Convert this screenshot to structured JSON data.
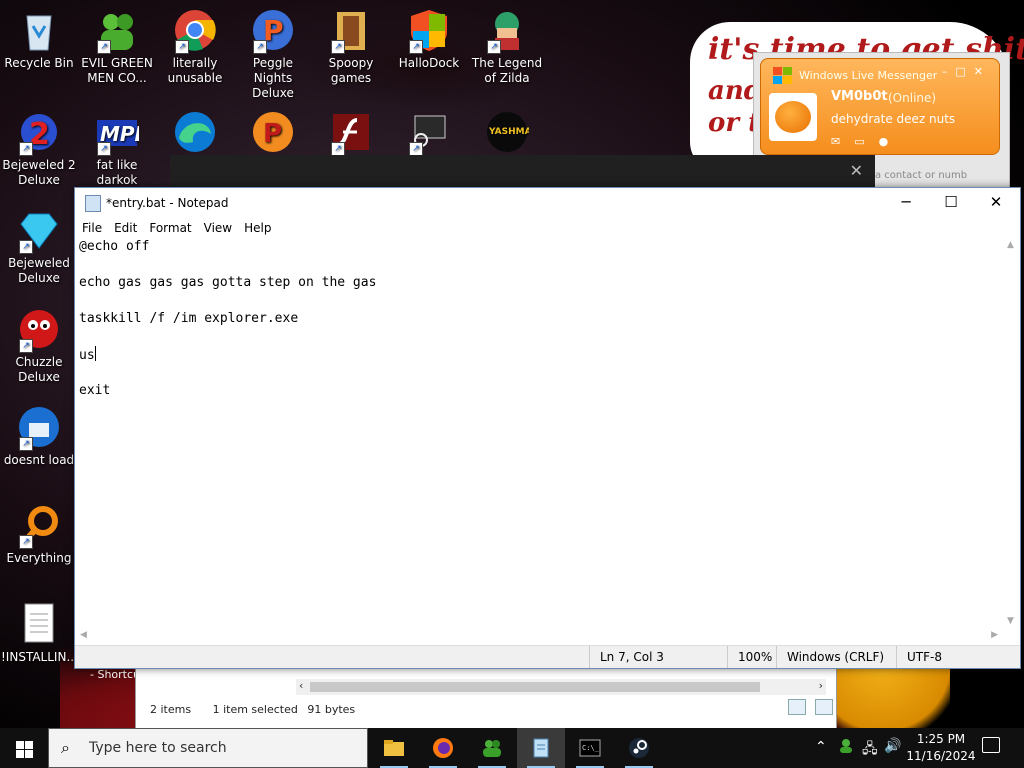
{
  "desktop": {
    "wallpaper_text_1": "it's time to get shit",
    "wallpaper_text_2": "and",
    "wallpaper_text_3": "or t",
    "icons": [
      {
        "label": "Recycle Bin"
      },
      {
        "label": "EVIL GREEN MEN CO..."
      },
      {
        "label": "literally unusable"
      },
      {
        "label": "Peggle Nights Deluxe"
      },
      {
        "label": "Spoopy games"
      },
      {
        "label": "HalloDock"
      },
      {
        "label": "The Legend of Zilda"
      },
      {
        "label": "Bejeweled 2 Deluxe"
      },
      {
        "label": "fat like darkok"
      },
      {
        "label": "Bejeweled Deluxe"
      },
      {
        "label": "Chuzzle Deluxe"
      },
      {
        "label": "doesnt load"
      },
      {
        "label": "Everything"
      },
      {
        "label": "!INSTALLIN..."
      }
    ],
    "shortcut_fragment": "- Shortcu"
  },
  "messenger": {
    "title": "Windows Live Messenger",
    "username": "VM0b0t",
    "status": "(Online)",
    "personal_message": "dehydrate deez nuts",
    "search_placeholder": "a contact or numb"
  },
  "explorer": {
    "item_count": "2 items",
    "selection": "1 item selected",
    "size": "91 bytes"
  },
  "notepad": {
    "title": "*entry.bat - Notepad",
    "menu": [
      "File",
      "Edit",
      "Format",
      "View",
      "Help"
    ],
    "lines": [
      "@echo off",
      "echo gas gas gas gotta step on the gas",
      "taskkill /f /im explorer.exe",
      "us",
      "exit"
    ],
    "status": {
      "position": "Ln 7, Col 3",
      "zoom": "100%",
      "line_ending": "Windows (CRLF)",
      "encoding": "UTF-8"
    }
  },
  "taskbar": {
    "search_placeholder": "Type here to search",
    "time": "1:25 PM",
    "date": "11/16/2024"
  },
  "colors": {
    "messenger_orange": "#f58e1d",
    "notepad_border": "#6b8bb0",
    "taskbar": "#101010"
  }
}
